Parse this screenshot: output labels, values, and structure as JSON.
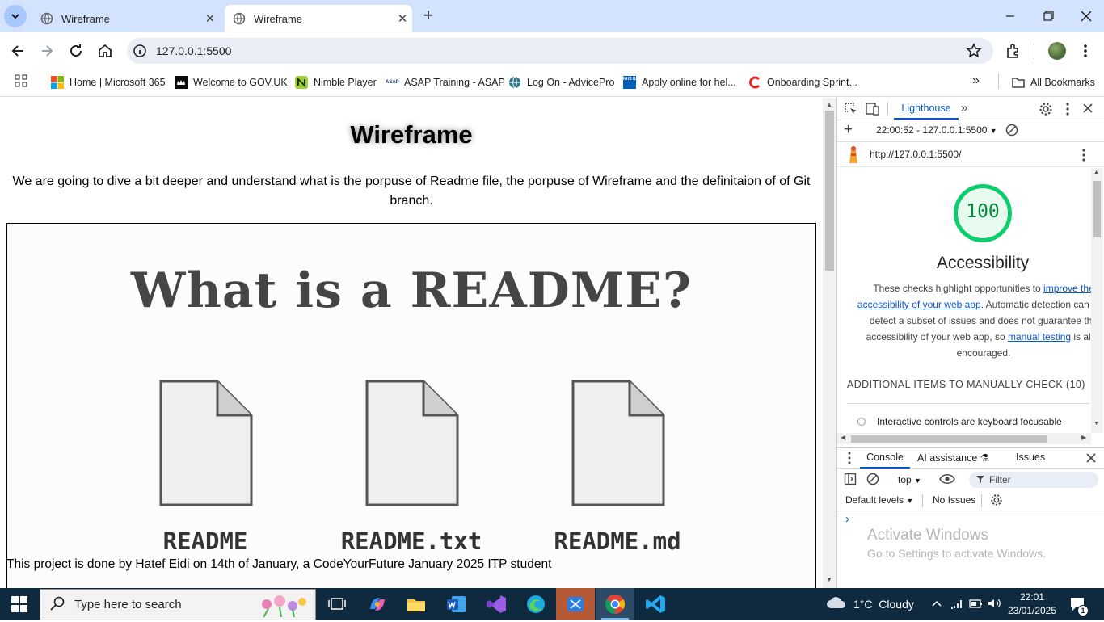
{
  "browser": {
    "tabs": [
      {
        "label": "Wireframe"
      },
      {
        "label": "Wireframe"
      }
    ],
    "url": "127.0.0.1:5500",
    "bookmarks": [
      {
        "label": "Home | Microsoft 365"
      },
      {
        "label": "Welcome to GOV.UK"
      },
      {
        "label": "Nimble Player"
      },
      {
        "label": "ASAP Training - ASAP"
      },
      {
        "label": "Log On - AdvicePro"
      },
      {
        "label": "Apply online for hel..."
      },
      {
        "label": "Onboarding Sprint..."
      }
    ],
    "all_bookmarks": "All Bookmarks",
    "nhs_icon_text": "NHS BSA",
    "asap_icon_text": "ASAP"
  },
  "page": {
    "heading": "Wireframe",
    "intro": "We are going to dive a bit deeper and understand what is the porpuse of Readme file, the porpuse of Wireframe and the definitaion of of Git branch.",
    "image": {
      "title": "What is a README?",
      "files": [
        "README",
        "README.txt",
        "README.md"
      ]
    },
    "footer": "This project is done by Hatef Eidi on 14th of January, a CodeYourFuture January 2025 ITP student"
  },
  "devtools": {
    "panel_tab": "Lighthouse",
    "report_select": "22:00:52 - 127.0.0.1:5500",
    "report_url": "http://127.0.0.1:5500/",
    "score": "100",
    "score_color": "#0cce6b",
    "category": "Accessibility",
    "desc_1": "These checks highlight opportunities to ",
    "desc_link_1": "improve the accessibility of your web app",
    "desc_2": ". Automatic detection can only detect a subset of issues and does not guarantee the accessibility of your web app, so ",
    "desc_link_2": "manual testing",
    "desc_3": " is also encouraged.",
    "section": "ADDITIONAL ITEMS TO MANUALLY CHECK (10)",
    "item_1": "Interactive controls are keyboard focusable",
    "drawer_tabs": [
      "Console",
      "AI assistance",
      "Issues"
    ],
    "context": "top",
    "filter_placeholder": "Filter",
    "levels": "Default levels",
    "no_issues": "No Issues",
    "prompt": "›"
  },
  "watermark": {
    "title": "Activate Windows",
    "subtitle": "Go to Settings to activate Windows."
  },
  "taskbar": {
    "search_placeholder": "Type here to search",
    "weather": "1°C  Cloudy",
    "time": "22:01",
    "date": "23/01/2025",
    "notification_count": "1"
  }
}
